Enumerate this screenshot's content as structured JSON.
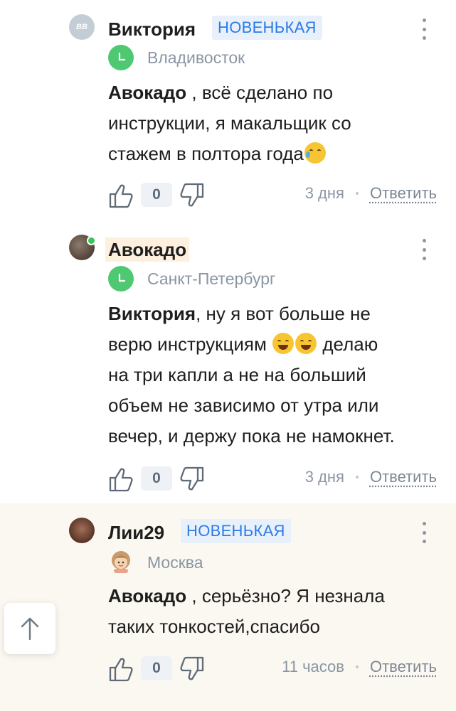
{
  "comments": [
    {
      "author": "Виктория",
      "avatar_initials": "ВВ",
      "badge": "НОВЕНЬКАЯ",
      "city": "Владивосток",
      "mention": "Авокадо",
      "text_1": " , всё сделано по",
      "text_2": "инструкции, я макальщик со",
      "text_3": "стажем в полтора года",
      "likes": "0",
      "time": "3 дня",
      "reply": "Ответить"
    },
    {
      "author": "Авокадо",
      "city": "Санкт-Петербург",
      "mention": "Виктория",
      "text_1": ", ну я вот больше не",
      "text_2a": "верю инструкциям ",
      "text_2b": " делаю",
      "text_3": "на три капли а не на больший",
      "text_4": "объем не зависимо от утра или",
      "text_5": "вечер, и держу пока не намокнет.",
      "likes": "0",
      "time": "3 дня",
      "reply": "Ответить"
    },
    {
      "author": "Лии29",
      "badge": "НОВЕНЬКАЯ",
      "city": "Москва",
      "mention": "Авокадо",
      "text_1": " , серьёзно? Я незнала",
      "text_2": "таких тонкостей,спасибо",
      "likes": "0",
      "time": "11 часов",
      "reply": "Ответить"
    }
  ],
  "icons": {
    "thumb_up": "thumb-up-icon",
    "thumb_down": "thumb-down-icon",
    "more": "more-vertical-icon",
    "scroll_top": "arrow-up-icon"
  },
  "colors": {
    "badge": "#2c7be5",
    "city_icon": "#4fc872",
    "highlight_bg": "#fbf8f1"
  }
}
